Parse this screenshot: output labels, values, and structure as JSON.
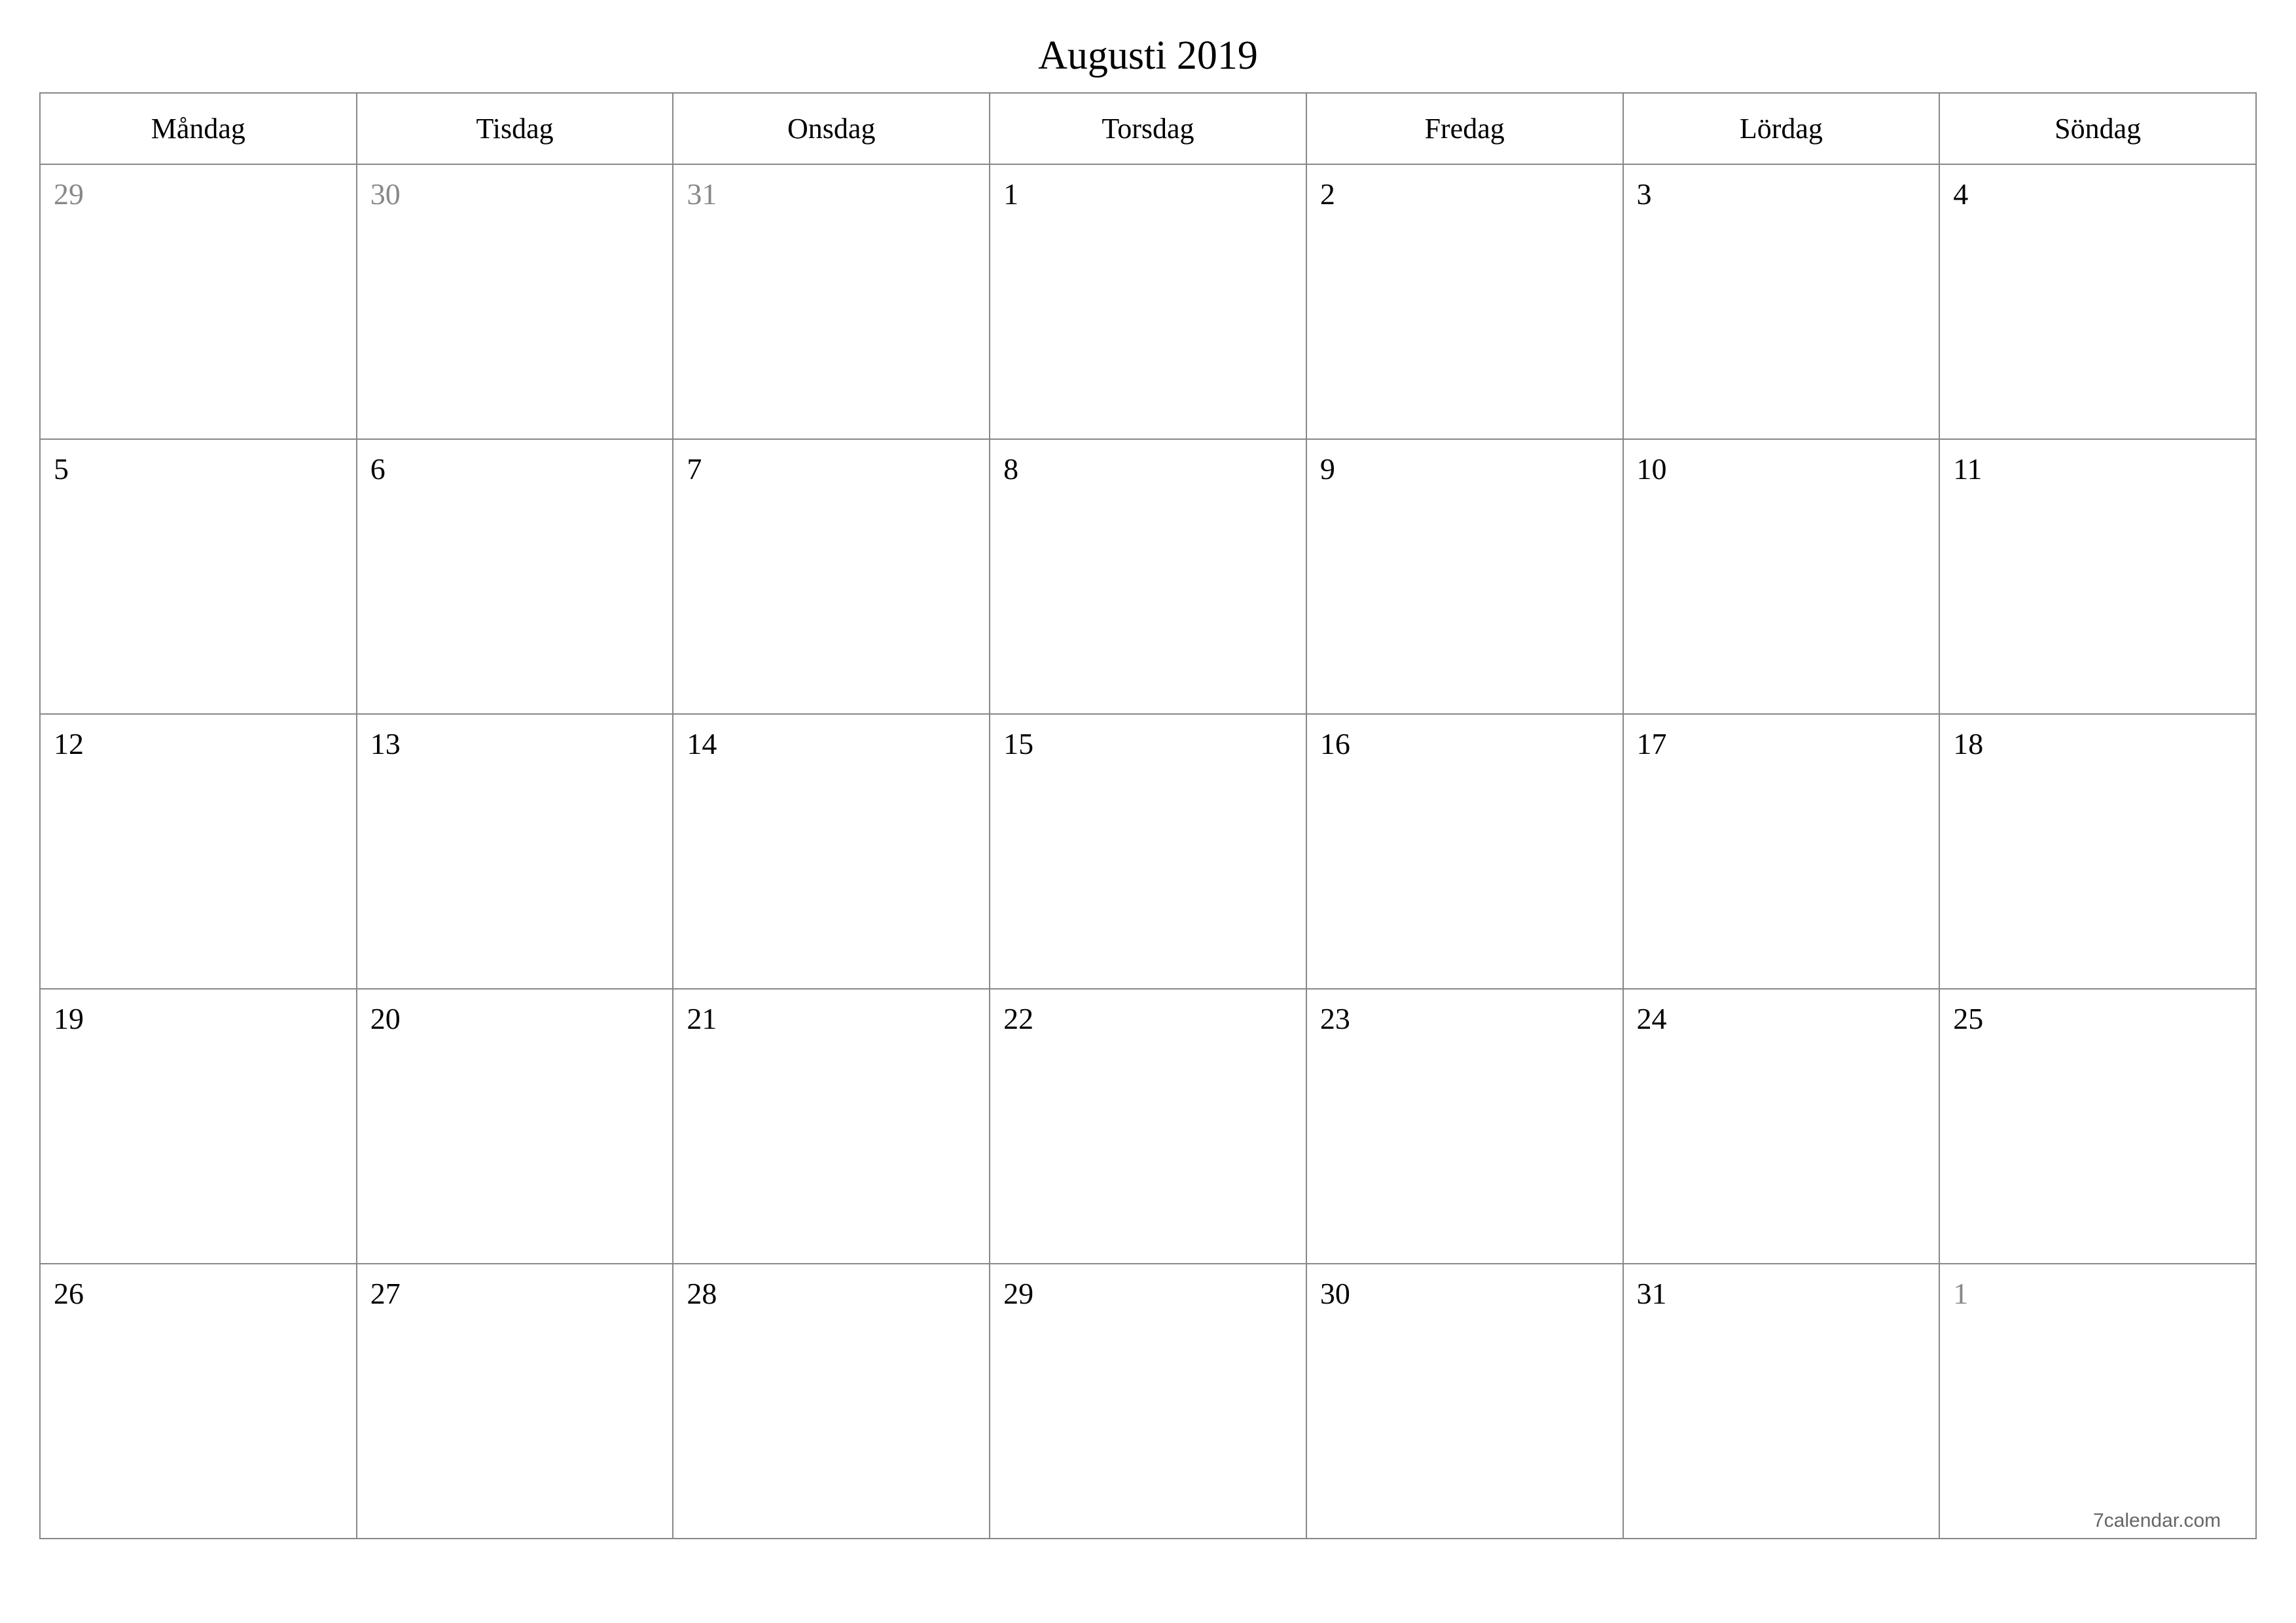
{
  "title": "Augusti 2019",
  "weekdays": [
    "Måndag",
    "Tisdag",
    "Onsdag",
    "Torsdag",
    "Fredag",
    "Lördag",
    "Söndag"
  ],
  "weeks": [
    [
      {
        "day": "29",
        "other": true
      },
      {
        "day": "30",
        "other": true
      },
      {
        "day": "31",
        "other": true
      },
      {
        "day": "1",
        "other": false
      },
      {
        "day": "2",
        "other": false
      },
      {
        "day": "3",
        "other": false
      },
      {
        "day": "4",
        "other": false
      }
    ],
    [
      {
        "day": "5",
        "other": false
      },
      {
        "day": "6",
        "other": false
      },
      {
        "day": "7",
        "other": false
      },
      {
        "day": "8",
        "other": false
      },
      {
        "day": "9",
        "other": false
      },
      {
        "day": "10",
        "other": false
      },
      {
        "day": "11",
        "other": false
      }
    ],
    [
      {
        "day": "12",
        "other": false
      },
      {
        "day": "13",
        "other": false
      },
      {
        "day": "14",
        "other": false
      },
      {
        "day": "15",
        "other": false
      },
      {
        "day": "16",
        "other": false
      },
      {
        "day": "17",
        "other": false
      },
      {
        "day": "18",
        "other": false
      }
    ],
    [
      {
        "day": "19",
        "other": false
      },
      {
        "day": "20",
        "other": false
      },
      {
        "day": "21",
        "other": false
      },
      {
        "day": "22",
        "other": false
      },
      {
        "day": "23",
        "other": false
      },
      {
        "day": "24",
        "other": false
      },
      {
        "day": "25",
        "other": false
      }
    ],
    [
      {
        "day": "26",
        "other": false
      },
      {
        "day": "27",
        "other": false
      },
      {
        "day": "28",
        "other": false
      },
      {
        "day": "29",
        "other": false
      },
      {
        "day": "30",
        "other": false
      },
      {
        "day": "31",
        "other": false
      },
      {
        "day": "1",
        "other": true
      }
    ]
  ],
  "footer": "7calendar.com"
}
